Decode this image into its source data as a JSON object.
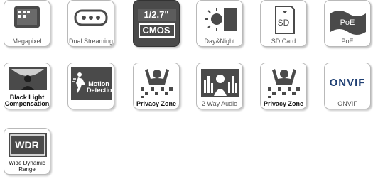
{
  "features": [
    {
      "key": "megapixel",
      "label": "Megapixel"
    },
    {
      "key": "dual_streaming",
      "label": "Dual Streaming"
    },
    {
      "key": "cmos",
      "label": "",
      "top_text": "1/2.7\"",
      "bottom_text": "CMOS"
    },
    {
      "key": "day_night",
      "label": "Day&Night"
    },
    {
      "key": "sd_card",
      "label": "SD Card",
      "icon_text": "SD"
    },
    {
      "key": "poe",
      "label": "PoE",
      "icon_text": "PoE"
    },
    {
      "key": "blc",
      "label_line1": "Black Light",
      "label_line2": "Compensation"
    },
    {
      "key": "motion_detection",
      "line1": "Motion",
      "line2": "Detection"
    },
    {
      "key": "privacy_zone_1",
      "label": "Privacy Zone"
    },
    {
      "key": "two_way_audio",
      "label": "2 Way Audio"
    },
    {
      "key": "privacy_zone_2",
      "label": "Privacy Zone"
    },
    {
      "key": "onvif",
      "label": "ONVIF",
      "icon_text": "ONVIF"
    },
    {
      "key": "wdr",
      "icon_text": "WDR",
      "label_line1": "Wide Dynamic",
      "label_line2": "Range"
    }
  ],
  "colors": {
    "icon_dark": "#4a4a4a",
    "tile_border": "#b9b9b9",
    "onvif_blue": "#1f3f73",
    "label_gray": "#555555"
  }
}
